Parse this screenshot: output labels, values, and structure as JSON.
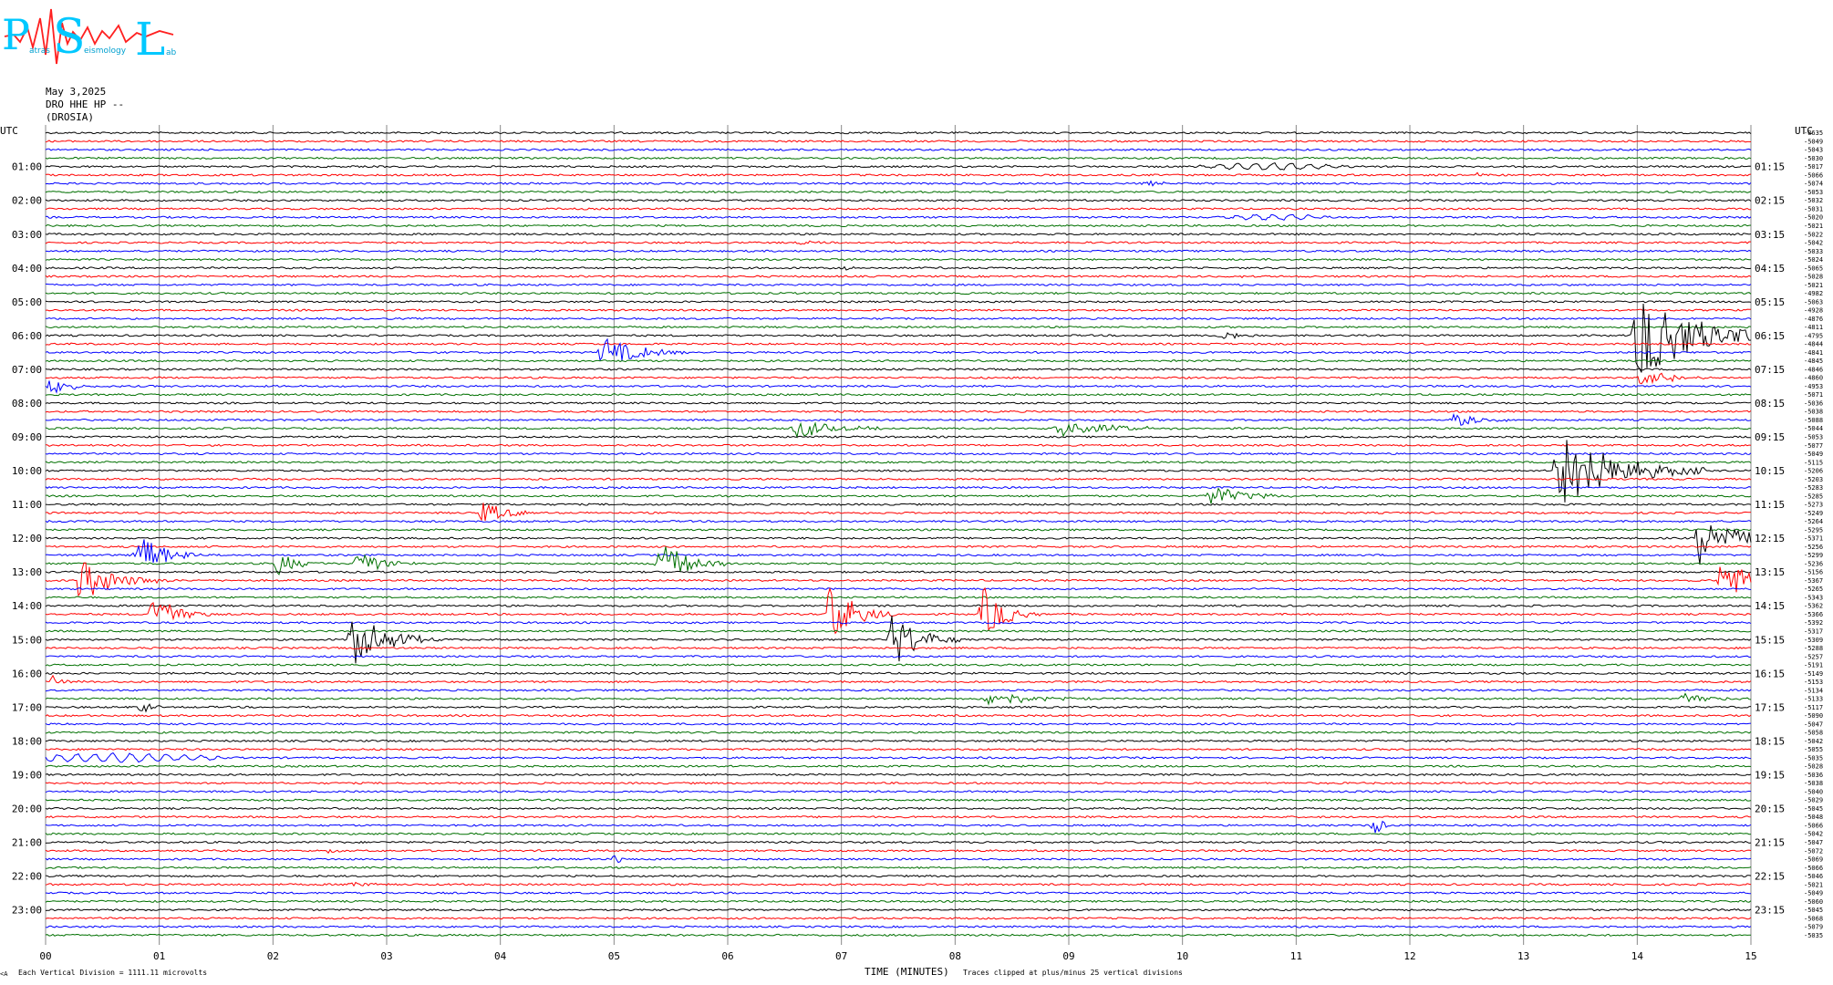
{
  "logo": {
    "letters": [
      "P",
      "S",
      "L"
    ],
    "subtext": [
      "atras",
      "eismology",
      "ab"
    ]
  },
  "header": {
    "date": "May 3,2025",
    "channel": "DRO HHE HP --",
    "station": "(DROSIA)"
  },
  "axis": {
    "utc_left": "UTC",
    "utc_right": "UTC",
    "x_title": "TIME (MINUTES)"
  },
  "footer": {
    "scale_note": "Each Vertical Division = 1111.11 microvolts",
    "clip_note": "Traces clipped at plus/minus 25 vertical divisions",
    "corner_mark": "<A"
  },
  "colors": {
    "trace_cycle": [
      "#000000",
      "#ff0000",
      "#0000ff",
      "#007000"
    ],
    "grid": "#888888",
    "logo_cyan": "#00c8ff",
    "logo_red": "#ff2020"
  },
  "chart_data": {
    "type": "line",
    "subtype": "helicorder",
    "rows": 96,
    "row_minutes": 15,
    "xlim": [
      0,
      15
    ],
    "x_ticks": [
      "00",
      "01",
      "02",
      "03",
      "04",
      "05",
      "06",
      "07",
      "08",
      "09",
      "10",
      "11",
      "12",
      "13",
      "14",
      "15"
    ],
    "left_hour_labels": [
      "01:00",
      "02:00",
      "03:00",
      "04:00",
      "05:00",
      "06:00",
      "07:00",
      "08:00",
      "09:00",
      "10:00",
      "11:00",
      "12:00",
      "13:00",
      "14:00",
      "15:00",
      "16:00",
      "17:00",
      "18:00",
      "19:00",
      "20:00",
      "21:00",
      "22:00",
      "23:00"
    ],
    "right_hour_labels": [
      "01:15",
      "02:15",
      "03:15",
      "04:15",
      "05:15",
      "06:15",
      "07:15",
      "08:15",
      "09:15",
      "10:15",
      "11:15",
      "12:15",
      "13:15",
      "14:15",
      "15:15",
      "16:15",
      "17:15",
      "18:15",
      "19:15",
      "20:15",
      "21:15",
      "22:15",
      "23:15"
    ],
    "row_offsets": [
      "-8635",
      "-5049",
      "-5043",
      "-5030",
      "-5017",
      "-5066",
      "-5074",
      "-5053",
      "-5032",
      "-5031",
      "-5020",
      "-5021",
      "-5022",
      "-5042",
      "-5033",
      "-5024",
      "-5065",
      "-5028",
      "-5021",
      "-4982",
      "-5063",
      "-4928",
      "-4876",
      "-4811",
      "-4795",
      "-4844",
      "-4841",
      "-4845",
      "-4846",
      "-4860",
      "-4953",
      "-5071",
      "-5036",
      "-5038",
      "-5088",
      "-5044",
      "-5053",
      "-5077",
      "-5049",
      "-5115",
      "-5206",
      "-5203",
      "-5283",
      "-5285",
      "-5273",
      "-5249",
      "-5264",
      "-5295",
      "-5371",
      "-5256",
      "-5299",
      "-5236",
      "-5156",
      "-5367",
      "-5265",
      "-5343",
      "-5362",
      "-5366",
      "-5392",
      "-5317",
      "-5309",
      "-5288",
      "-5257",
      "-5191",
      "-5149",
      "-5153",
      "-5134",
      "-5133",
      "-5117",
      "-5090",
      "-5047",
      "-5058",
      "-5042",
      "-5055",
      "-5035",
      "-5028",
      "-5036",
      "-5038",
      "-5040",
      "-5029",
      "-5045",
      "-5048",
      "-5066",
      "-5042",
      "-5047",
      "-5072",
      "-5069",
      "-5066",
      "-5046",
      "-5021",
      "-5049",
      "-5060",
      "-5045",
      "-5068",
      "-5079",
      "-5035"
    ],
    "events": [
      {
        "row": 4,
        "minute": 10.8,
        "amp": 0.4,
        "dur": 1.6,
        "kind": "lp"
      },
      {
        "row": 5,
        "minute": 12.6,
        "amp": 0.3,
        "dur": 0.2
      },
      {
        "row": 6,
        "minute": 9.65,
        "amp": 0.5,
        "dur": 0.4
      },
      {
        "row": 10,
        "minute": 10.8,
        "amp": 0.3,
        "dur": 1.2,
        "kind": "lp"
      },
      {
        "row": 13,
        "minute": 6.65,
        "amp": 0.3,
        "dur": 0.2
      },
      {
        "row": 16,
        "minute": 7.05,
        "amp": 0.3,
        "dur": 0.1
      },
      {
        "row": 17,
        "minute": 10.5,
        "amp": 0.3,
        "dur": 0.1
      },
      {
        "row": 24,
        "minute": 14.0,
        "amp": 5.5,
        "dur": 1.4
      },
      {
        "row": 24,
        "minute": 10.35,
        "amp": 1.0,
        "dur": 0.3
      },
      {
        "row": 26,
        "minute": 4.9,
        "amp": 2.0,
        "dur": 0.8
      },
      {
        "row": 29,
        "minute": 14.05,
        "amp": 1.5,
        "dur": 0.6
      },
      {
        "row": 30,
        "minute": 0.05,
        "amp": 1.2,
        "dur": 0.4
      },
      {
        "row": 35,
        "minute": 6.6,
        "amp": 1.2,
        "dur": 0.8
      },
      {
        "row": 35,
        "minute": 8.9,
        "amp": 1.0,
        "dur": 1.2
      },
      {
        "row": 34,
        "minute": 12.4,
        "amp": 0.9,
        "dur": 0.6
      },
      {
        "row": 40,
        "minute": 13.3,
        "amp": 5.0,
        "dur": 1.3
      },
      {
        "row": 43,
        "minute": 10.25,
        "amp": 1.3,
        "dur": 0.8
      },
      {
        "row": 45,
        "minute": 3.85,
        "amp": 1.3,
        "dur": 0.6
      },
      {
        "row": 48,
        "minute": 14.55,
        "amp": 3.2,
        "dur": 0.8
      },
      {
        "row": 50,
        "minute": 0.8,
        "amp": 3.0,
        "dur": 0.6
      },
      {
        "row": 51,
        "minute": 5.4,
        "amp": 3.0,
        "dur": 0.6
      },
      {
        "row": 51,
        "minute": 2.05,
        "amp": 1.6,
        "dur": 0.4
      },
      {
        "row": 51,
        "minute": 2.75,
        "amp": 1.8,
        "dur": 0.5
      },
      {
        "row": 53,
        "minute": 0.3,
        "amp": 2.6,
        "dur": 0.8
      },
      {
        "row": 53,
        "minute": 14.75,
        "amp": 3.2,
        "dur": 0.6
      },
      {
        "row": 57,
        "minute": 6.9,
        "amp": 3.8,
        "dur": 0.6
      },
      {
        "row": 57,
        "minute": 8.25,
        "amp": 3.2,
        "dur": 0.5
      },
      {
        "row": 57,
        "minute": 0.95,
        "amp": 3.2,
        "dur": 0.5
      },
      {
        "row": 60,
        "minute": 2.7,
        "amp": 3.2,
        "dur": 0.8
      },
      {
        "row": 60,
        "minute": 7.45,
        "amp": 3.6,
        "dur": 0.6
      },
      {
        "row": 65,
        "minute": 0.05,
        "amp": 0.8,
        "dur": 0.3
      },
      {
        "row": 67,
        "minute": 8.3,
        "amp": 1.0,
        "dur": 0.9
      },
      {
        "row": 67,
        "minute": 14.4,
        "amp": 0.8,
        "dur": 0.6
      },
      {
        "row": 68,
        "minute": 0.85,
        "amp": 0.6,
        "dur": 0.3
      },
      {
        "row": 74,
        "minute": 0.6,
        "amp": 0.5,
        "dur": 2.2,
        "kind": "lp"
      },
      {
        "row": 82,
        "minute": 11.7,
        "amp": 1.2,
        "dur": 0.2
      },
      {
        "row": 85,
        "minute": 2.5,
        "amp": 0.5,
        "dur": 0.2
      },
      {
        "row": 86,
        "minute": 5.0,
        "amp": 0.6,
        "dur": 0.3
      },
      {
        "row": 89,
        "minute": 2.7,
        "amp": 0.5,
        "dur": 0.3
      }
    ]
  }
}
